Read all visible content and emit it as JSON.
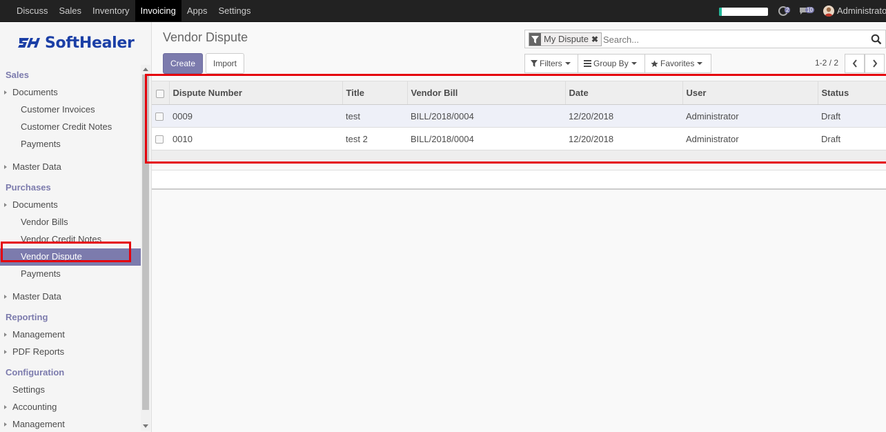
{
  "topbar": {
    "menu": [
      "Discuss",
      "Sales",
      "Inventory",
      "Invoicing",
      "Apps",
      "Settings"
    ],
    "active_index": 3,
    "progress_fraction": 0.05,
    "chat_count": "2",
    "message_count": "10",
    "user_name": "Administrator"
  },
  "logo": {
    "text": "SoftHealer"
  },
  "sidebar": {
    "sales_title": "Sales",
    "sales_documents": "Documents",
    "customer_invoices": "Customer Invoices",
    "customer_credit_notes": "Customer Credit Notes",
    "sales_payments": "Payments",
    "sales_master_data": "Master Data",
    "purchases_title": "Purchases",
    "purchases_documents": "Documents",
    "vendor_bills": "Vendor Bills",
    "vendor_credit_notes": "Vendor Credit Notes",
    "vendor_dispute": "Vendor Dispute",
    "purchases_payments": "Payments",
    "purchases_master_data": "Master Data",
    "reporting_title": "Reporting",
    "management": "Management",
    "pdf_reports": "PDF Reports",
    "configuration_title": "Configuration",
    "settings": "Settings",
    "accounting": "Accounting",
    "config_management": "Management"
  },
  "control": {
    "title": "Vendor Dispute",
    "create_label": "Create",
    "import_label": "Import",
    "facet_label": "My Dispute",
    "search_placeholder": "Search...",
    "filters_label": "Filters",
    "groupby_label": "Group By",
    "favorites_label": "Favorites",
    "pager_text": "1-2 / 2"
  },
  "table": {
    "columns": [
      "Dispute Number",
      "Title",
      "Vendor Bill",
      "Date",
      "User",
      "Status"
    ],
    "rows": [
      [
        "0009",
        "test",
        "BILL/2018/0004",
        "12/20/2018",
        "Administrator",
        "Draft"
      ],
      [
        "0010",
        "test 2",
        "BILL/2018/0004",
        "12/20/2018",
        "Administrator",
        "Draft"
      ]
    ]
  },
  "colors": {
    "accent": "#7c7bad",
    "highlight_box": "#e5000c",
    "topbar": "#222222"
  }
}
